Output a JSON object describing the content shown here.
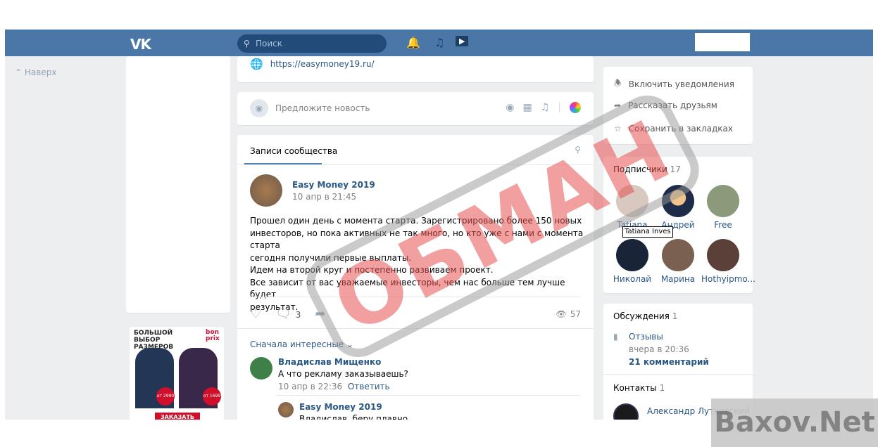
{
  "header": {
    "logo": "VK",
    "search_placeholder": "Поиск",
    "icons": [
      "bell-icon",
      "music-icon",
      "video-play-icon"
    ]
  },
  "left": {
    "back_to_top": "Наверх"
  },
  "ad": {
    "title": "БОЛЬШОЙ ВЫБОР РАЗМЕРОВ",
    "brand": "bon prix",
    "price1": "от 2990 р",
    "price2": "от 1699 р",
    "button": "ЗАКАЗАТЬ"
  },
  "info": {
    "website": "https://easymoney19.ru/"
  },
  "suggest": {
    "placeholder": "Предложите новость"
  },
  "wall": {
    "tab": "Записи сообщества",
    "post": {
      "author": "Easy Money 2019",
      "date": "10 апр в 21:45",
      "lines": [
        "Прошел один день с момента старта. Зарегистрировано более 150 новых",
        "инвесторов, но пока активных не так много, но кто уже с нами с момента старта",
        "сегодня получили первые выплаты.",
        "Идем на второй круг и постепенно развиваем проект.",
        "Все зависит от вас уважаемые инвесторы, чем нас больше тем лучше будет",
        "результат."
      ],
      "comments_count": "3",
      "views": "57"
    },
    "sort": "Сначала интересные",
    "comments": [
      {
        "author": "Владислав Мищенко",
        "text": "А что рекламу заказываешь?",
        "date": "10 апр в 22:36",
        "reply": "Ответить"
      },
      {
        "author": "Easy Money 2019",
        "text": "Владислав, беру плавно"
      }
    ]
  },
  "actions": [
    "Включить уведомления",
    "Рассказать друзьям",
    "Сохранить в закладках"
  ],
  "subscribers": {
    "title": "Подписчики",
    "count": "17",
    "items": [
      "Tatiana",
      "Андрей",
      "Free",
      "Николай",
      "Марина",
      "Hothyipmo..."
    ],
    "tooltip": "Tatiana Inves"
  },
  "discussions": {
    "title": "Обсуждения",
    "count": "1",
    "topic": "Отзывы",
    "date": "вчера в 20:36",
    "comments": "21 комментарий"
  },
  "contacts": {
    "title": "Контакты",
    "count": "1",
    "name": "Александр Лутковский"
  },
  "stamp": "ОБМАН",
  "watermark": "Baxov.Net"
}
